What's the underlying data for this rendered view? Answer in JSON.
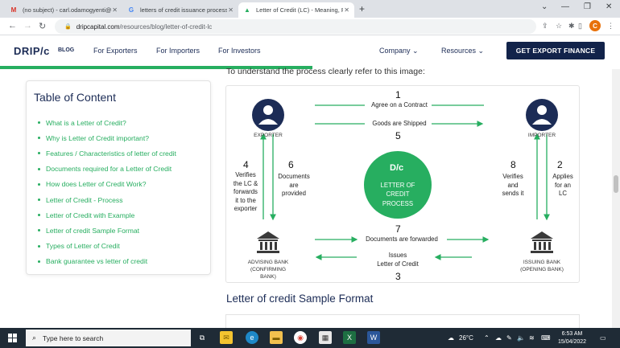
{
  "browser": {
    "tabs": [
      {
        "icon": "gmail-icon",
        "label": "(no subject) - carl.odamogyenti@...",
        "active": false
      },
      {
        "icon": "google-icon",
        "label": "letters of credit issuance process - ...",
        "active": false
      },
      {
        "icon": "drip-favicon-icon",
        "label": "Letter of Credit (LC) - Meaning, P...",
        "active": true
      }
    ],
    "url_host": "dripcapital.com",
    "url_path": "/resources/blog/letter-of-credit-lc",
    "profile_initial": "C"
  },
  "site": {
    "logo": "DRIP/c",
    "logo_sub": "BLOG",
    "nav": [
      "For Exporters",
      "For Importers",
      "For Investors"
    ],
    "nav_dropdowns": [
      "Company",
      "Resources"
    ],
    "cta": "GET EXPORT FINANCE"
  },
  "toc": {
    "title": "Table of Content",
    "items": [
      "What is a Letter of Credit?",
      "Why is Letter of Credit important?",
      "Features / Characteristics of letter of credit",
      "Documents required for a Letter of Credit",
      "How does Letter of Credit Work?",
      "Letter of Credit - Process",
      "Letter of Credit with Example",
      "Letter of credit Sample Format",
      "Types of Letter of Credit",
      "Bank guarantee vs letter of credit"
    ]
  },
  "article": {
    "intro": "To understand the process clearly refer to this image:",
    "section_title": "Letter of credit Sample Format"
  },
  "diagram": {
    "exporter": "EXPORTER",
    "importer": "IMPORTER",
    "advising_bank": [
      "ADVISING BANK",
      "(CONFIRMING",
      "BANK)"
    ],
    "issuing_bank": [
      "ISSUING BANK",
      "(OPENING BANK)"
    ],
    "center_logo": "D/c",
    "center": [
      "LETTER OF",
      "CREDIT",
      "PROCESS"
    ],
    "steps": {
      "n1": "1",
      "s1": "Agree on a Contract",
      "s5": "Goods are Shipped",
      "n5": "5",
      "n4": "4",
      "s4": [
        "Verifies",
        "the LC &",
        "forwards",
        "it to the",
        "exporter"
      ],
      "n6": "6",
      "s6": [
        "Documents",
        "are",
        "provided"
      ],
      "n8": "8",
      "s8": [
        "Verifies",
        "and",
        "sends it"
      ],
      "n2": "2",
      "s2": [
        "Applies",
        "for an",
        "LC"
      ],
      "n7": "7",
      "s7": "Documents are forwarded",
      "s3": [
        "Issues",
        "Letter of Credit"
      ],
      "n3": "3"
    },
    "colors": {
      "green": "#27ae60",
      "navy": "#1c2c56"
    }
  },
  "taskbar": {
    "search_placeholder": "Type here to search",
    "weather": "26°C",
    "time": "6:53 AM",
    "date": "15/04/2022"
  }
}
